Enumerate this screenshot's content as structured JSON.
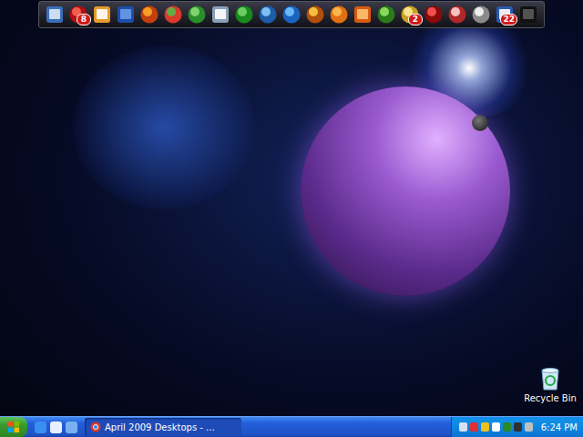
{
  "dock": {
    "items": [
      {
        "badge": ""
      },
      {
        "badge": "8"
      },
      {
        "badge": ""
      },
      {
        "badge": ""
      },
      {
        "badge": ""
      },
      {
        "badge": ""
      },
      {
        "badge": ""
      },
      {
        "badge": ""
      },
      {
        "badge": ""
      },
      {
        "badge": ""
      },
      {
        "badge": ""
      },
      {
        "badge": ""
      },
      {
        "badge": ""
      },
      {
        "badge": ""
      },
      {
        "badge": ""
      },
      {
        "badge": "2"
      },
      {
        "badge": ""
      },
      {
        "badge": ""
      },
      {
        "badge": ""
      },
      {
        "badge": "22"
      },
      {
        "badge": ""
      }
    ]
  },
  "desktop_icons": [
    {
      "label": "Recycle Bin",
      "selected": false
    }
  ],
  "taskbar": {
    "quick_launch_count": 3,
    "tasks": [
      {
        "label": "April 2009 Desktops - ...",
        "selected": true
      }
    ],
    "tray_icon_count": 7,
    "clock": "6:24 PM"
  }
}
